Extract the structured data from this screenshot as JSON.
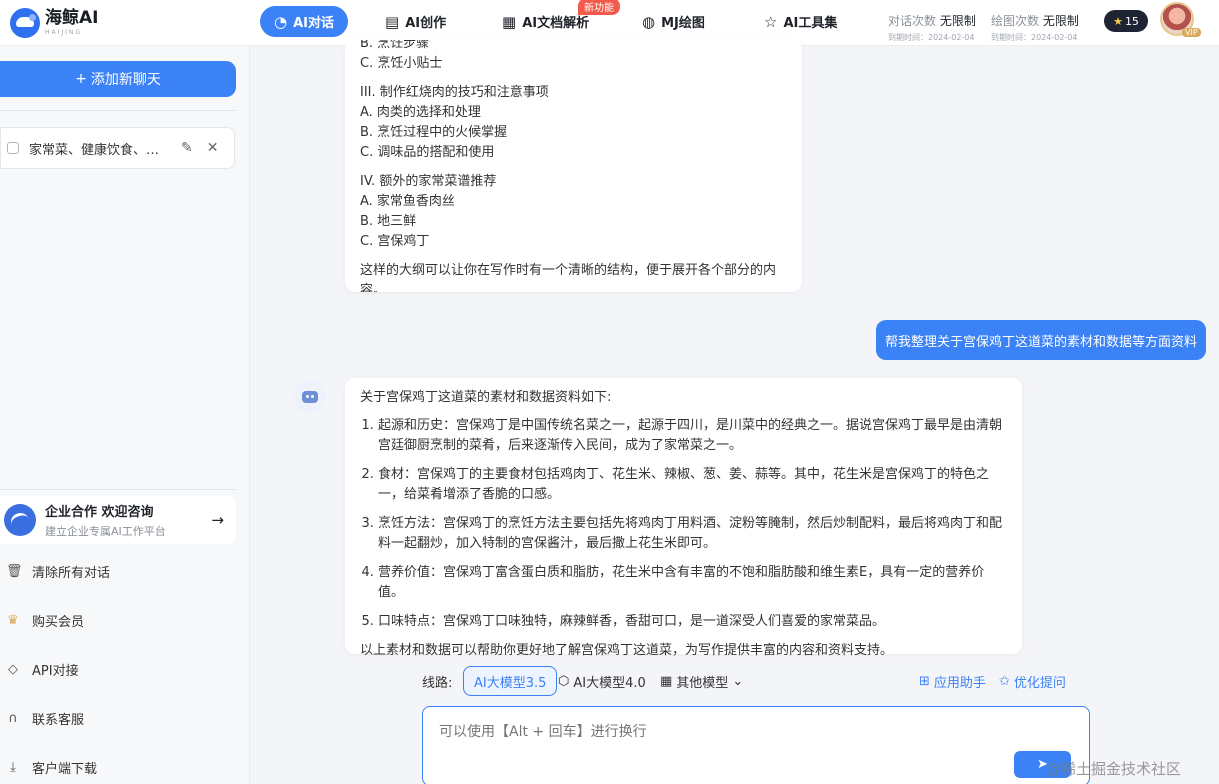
{
  "app": {
    "logo_text": "海鲸AI",
    "logo_sub": "HAIJING"
  },
  "nav": {
    "items": [
      {
        "label": "AI对话",
        "icon": "chat-icon"
      },
      {
        "label": "AI创作",
        "icon": "book-icon"
      },
      {
        "label": "AI文档解析",
        "icon": "pdf-icon"
      },
      {
        "label": "MJ绘图",
        "icon": "palette-icon"
      },
      {
        "label": "AI工具集",
        "icon": "star-icon"
      }
    ],
    "new_badge": "新功能"
  },
  "quota": {
    "chat_label": "对话次数",
    "chat_value": "无限制",
    "chat_expiry": "到期时间：2024-02-04",
    "draw_label": "绘图次数",
    "draw_value": "无限制",
    "draw_expiry": "到期时间：2024-02-04"
  },
  "user": {
    "stars": "15",
    "vip": "VIP"
  },
  "sidebar": {
    "add_chat": "添加新聊天",
    "chat_item": "家常菜、健康饮食、美食文化",
    "enterprise_title": "企业合作 欢迎咨询",
    "enterprise_sub": "建立企业专属AI工作平台",
    "links": [
      "清除所有对话",
      "购买会员",
      "API对接",
      "联系客服",
      "客户端下载"
    ]
  },
  "messages": {
    "ai_1": {
      "lines": [
        "B. 烹饪步骤",
        "C. 烹饪小贴士",
        "",
        "III. 制作红烧肉的技巧和注意事项",
        "A. 肉类的选择和处理",
        "B. 烹饪过程中的火候掌握",
        "C. 调味品的搭配和使用",
        "",
        "IV. 额外的家常菜谱推荐",
        "A. 家常鱼香肉丝",
        "B. 地三鲜",
        "C. 宫保鸡丁",
        "",
        "这样的大纲可以让你在写作时有一个清晰的结构，便于展开各个部分的内容。"
      ]
    },
    "user_1": "帮我整理关于宫保鸡丁这道菜的素材和数据等方面资料",
    "ai_2": {
      "intro": "关于宫保鸡丁这道菜的素材和数据资料如下:",
      "items": [
        "起源和历史：宫保鸡丁是中国传统名菜之一，起源于四川，是川菜中的经典之一。据说宫保鸡丁最早是由清朝宫廷御厨烹制的菜肴，后来逐渐传入民间，成为了家常菜之一。",
        "食材：宫保鸡丁的主要食材包括鸡肉丁、花生米、辣椒、葱、姜、蒜等。其中，花生米是宫保鸡丁的特色之一，给菜肴增添了香脆的口感。",
        "烹饪方法：宫保鸡丁的烹饪方法主要包括先将鸡肉丁用料酒、淀粉等腌制，然后炒制配料，最后将鸡肉丁和配料一起翻炒，加入特制的宫保酱汁，最后撒上花生米即可。",
        "营养价值：宫保鸡丁富含蛋白质和脂肪，花生米中含有丰富的不饱和脂肪酸和维生素E，具有一定的营养价值。",
        "口味特点：宫保鸡丁口味独特，麻辣鲜香，香甜可口，是一道深受人们喜爱的家常菜品。"
      ],
      "outro": "以上素材和数据可以帮助你更好地了解宫保鸡丁这道菜，为写作提供丰富的内容和资料支持。"
    }
  },
  "model_bar": {
    "label": "线路:",
    "model_35": "AI大模型3.5",
    "model_40": "AI大模型4.0",
    "other": "其他模型",
    "app_helper": "应用助手",
    "optimize": "优化提问"
  },
  "input": {
    "placeholder": "可以使用【Alt + 回车】进行换行"
  },
  "watermark": "@稀土掘金技术社区"
}
